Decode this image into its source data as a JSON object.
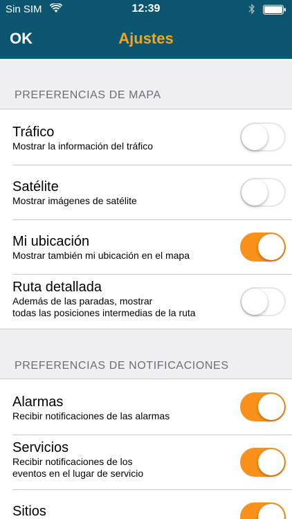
{
  "status_bar": {
    "carrier": "Sin SIM",
    "time": "12:39"
  },
  "nav": {
    "ok_label": "OK",
    "title": "Ajustes"
  },
  "colors": {
    "nav_bg": "#0b5570",
    "accent": "#f9911a",
    "title": "#f7a51c"
  },
  "map_section": {
    "header": "PREFERENCIAS DE MAPA",
    "items": [
      {
        "label": "Tráfico",
        "desc": "Mostrar la información del tráfico",
        "on": false
      },
      {
        "label": "Satélite",
        "desc": "Mostrar imágenes de satélite",
        "on": false
      },
      {
        "label": "Mi ubicación",
        "desc": "Mostrar también mi ubicación en el mapa",
        "on": true
      },
      {
        "label": "Ruta detallada",
        "desc_1": "Además de las paradas, mostrar",
        "desc_2": "todas las posiciones intermedias de la ruta",
        "on": false
      }
    ]
  },
  "notif_section": {
    "header": "PREFERENCIAS DE NOTIFICACIONES",
    "items": [
      {
        "label": "Alarmas",
        "desc": "Recibir notificaciones de las alarmas",
        "on": true
      },
      {
        "label": "Servicios",
        "desc_1": "Recibir notificaciones de los",
        "desc_2": "eventos en el lugar de servicio",
        "on": true
      },
      {
        "label": "Sitios",
        "on": true
      }
    ]
  }
}
